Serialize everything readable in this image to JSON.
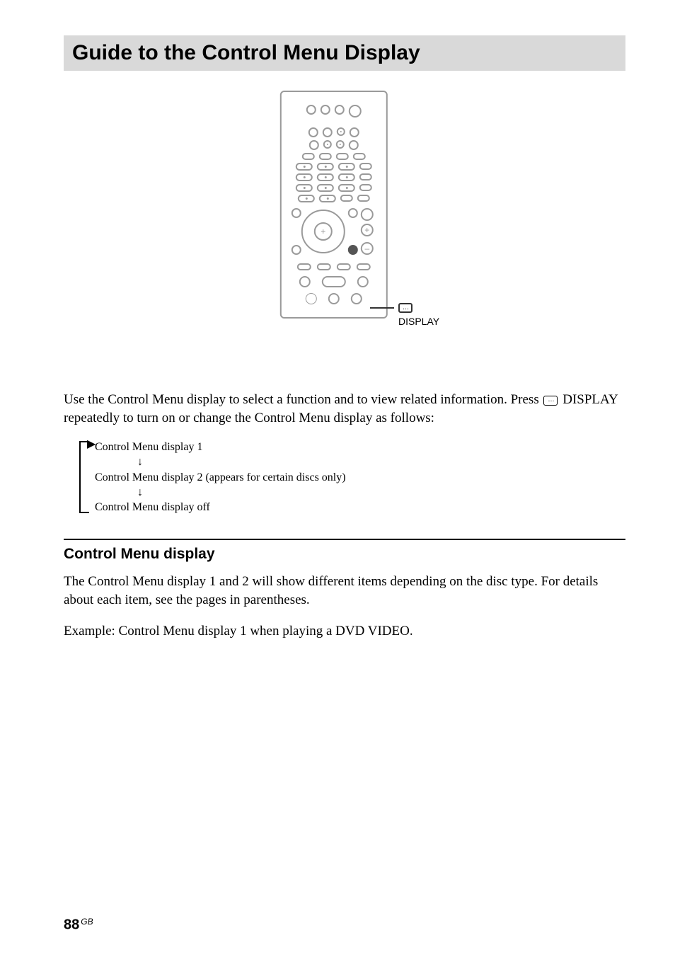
{
  "title": "Guide to the Control Menu Display",
  "callout_label": "DISPLAY",
  "intro_pre": "Use the Control Menu display to select a function and to view related information. Press ",
  "intro_post": " DISPLAY repeatedly to turn on or change the Control Menu display as follows:",
  "flow": {
    "line1": "Control Menu display 1",
    "line2": "Control Menu display 2 (appears for certain discs only)",
    "line3": "Control Menu display off"
  },
  "section_heading": "Control Menu display",
  "section_body": "The Control Menu display 1 and 2 will show different items depending on the disc type. For details about each item, see the pages in parentheses.",
  "example_line": "Example: Control Menu display 1 when playing a DVD VIDEO.",
  "page_number": "88",
  "page_suffix": "GB"
}
